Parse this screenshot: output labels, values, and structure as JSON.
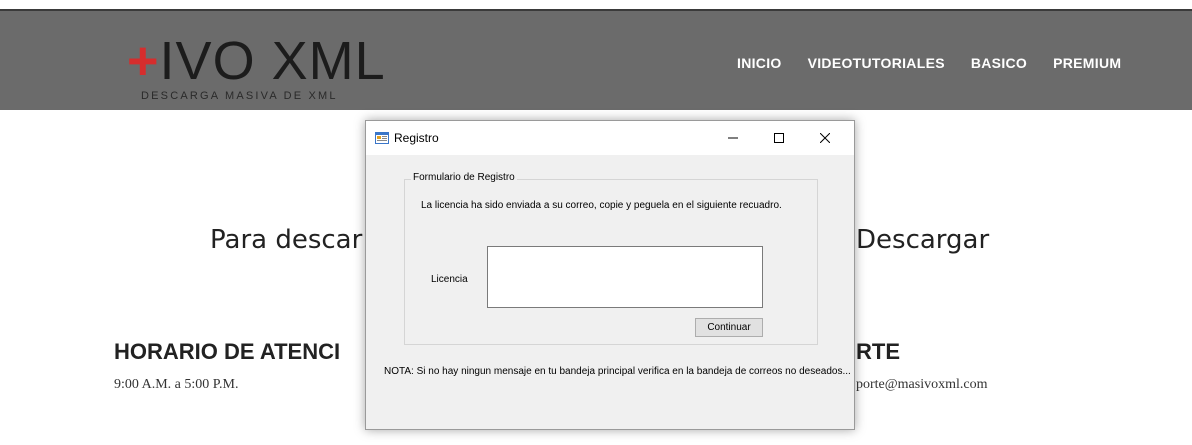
{
  "site": {
    "logo_plus": "+",
    "logo_text": "IVO XML",
    "logo_subtitle": "DESCARGA MASIVA DE XML",
    "nav": [
      "INICIO",
      "VIDEOTUTORIALES",
      "BASICO",
      "PREMIUM"
    ],
    "hero_left": "Para descar",
    "hero_right": "Descargar",
    "hours_title": "HORARIO DE ATENCI",
    "hours_text": "9:00 A.M. a 5:00 P.M.",
    "support_title": "RTE",
    "support_text": "porte@masivoxml.com",
    "header_color": "#6b6b6b",
    "accent_color": "#d62d2d"
  },
  "dialog": {
    "title": "Registro",
    "controls": {
      "minimize": "minimize-icon",
      "maximize": "maximize-icon",
      "close": "close-icon"
    },
    "group_title": "Formulario de Registro",
    "info": "La licencia ha sido enviada a su correo, copie y peguela  en el siguiente recuadro.",
    "license_label": "Licencia",
    "license_value": "",
    "continue_label": "Continuar",
    "note": "NOTA: Si no hay ningun mensaje en tu bandeja principal verifica en la bandeja de correos no deseados..."
  }
}
